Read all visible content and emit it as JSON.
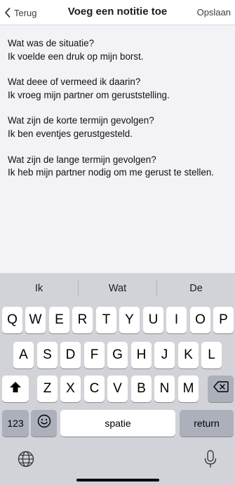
{
  "nav": {
    "back_label": "Terug",
    "title": "Voeg een notitie toe",
    "save_label": "Opslaan"
  },
  "note": {
    "blocks": [
      {
        "question": "Wat was de situatie?",
        "answer": "Ik voelde een druk op mijn borst."
      },
      {
        "question": "Wat deee of vermeed ik daarin?",
        "answer": "Ik vroeg mijn partner om geruststelling."
      },
      {
        "question": "Wat zijn de korte termijn gevolgen?",
        "answer": "Ik ben eventjes gerustgesteld."
      },
      {
        "question": "Wat zijn de lange termijn gevolgen?",
        "answer": "Ik heb mijn partner nodig om me gerust te stellen."
      }
    ]
  },
  "keyboard": {
    "suggestions": [
      "Ik",
      "Wat",
      "De"
    ],
    "row1": [
      "Q",
      "W",
      "E",
      "R",
      "T",
      "Y",
      "U",
      "I",
      "O",
      "P"
    ],
    "row2": [
      "A",
      "S",
      "D",
      "F",
      "G",
      "H",
      "J",
      "K",
      "L"
    ],
    "row3": [
      "Z",
      "X",
      "C",
      "V",
      "B",
      "N",
      "M"
    ],
    "numbers_label": "123",
    "space_label": "spatie",
    "return_label": "return",
    "icons": {
      "back": "chevron-left-icon",
      "shift": "shift-icon",
      "delete": "backspace-icon",
      "emoji": "emoji-icon",
      "globe": "globe-icon",
      "mic": "microphone-icon"
    }
  }
}
